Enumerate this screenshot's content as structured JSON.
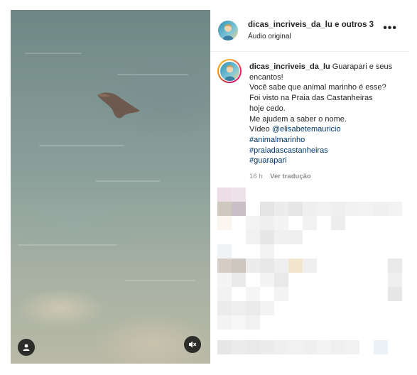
{
  "header": {
    "username": "dicas_incriveis_da_lu",
    "collaborators": "e outros 3",
    "audio": "Áudio original",
    "more_glyph": "•••"
  },
  "caption": {
    "username": "dicas_incriveis_da_lu",
    "first": "Guarapari e seus",
    "lines": [
      "encantos!",
      "Você sabe que animal marinho é esse?",
      "Foi visto na Praia das Castanheiras",
      "hoje cedo.",
      "Me ajudem a saber o nome."
    ],
    "credit_prefix": "Vídeo ",
    "credit_handle": "@elisabetemauricio",
    "hashtags": [
      "#animalmarinho",
      "#praiadascastanheiras",
      "#guarapari"
    ]
  },
  "meta": {
    "time": "16 h",
    "translate": "Ver tradução"
  },
  "icons": {
    "user": "user-icon",
    "mute": "muted-speaker-icon",
    "more": "more-options-icon"
  },
  "colors": {
    "link": "#00376b",
    "muted": "#8e8e8e",
    "text": "#262626"
  }
}
